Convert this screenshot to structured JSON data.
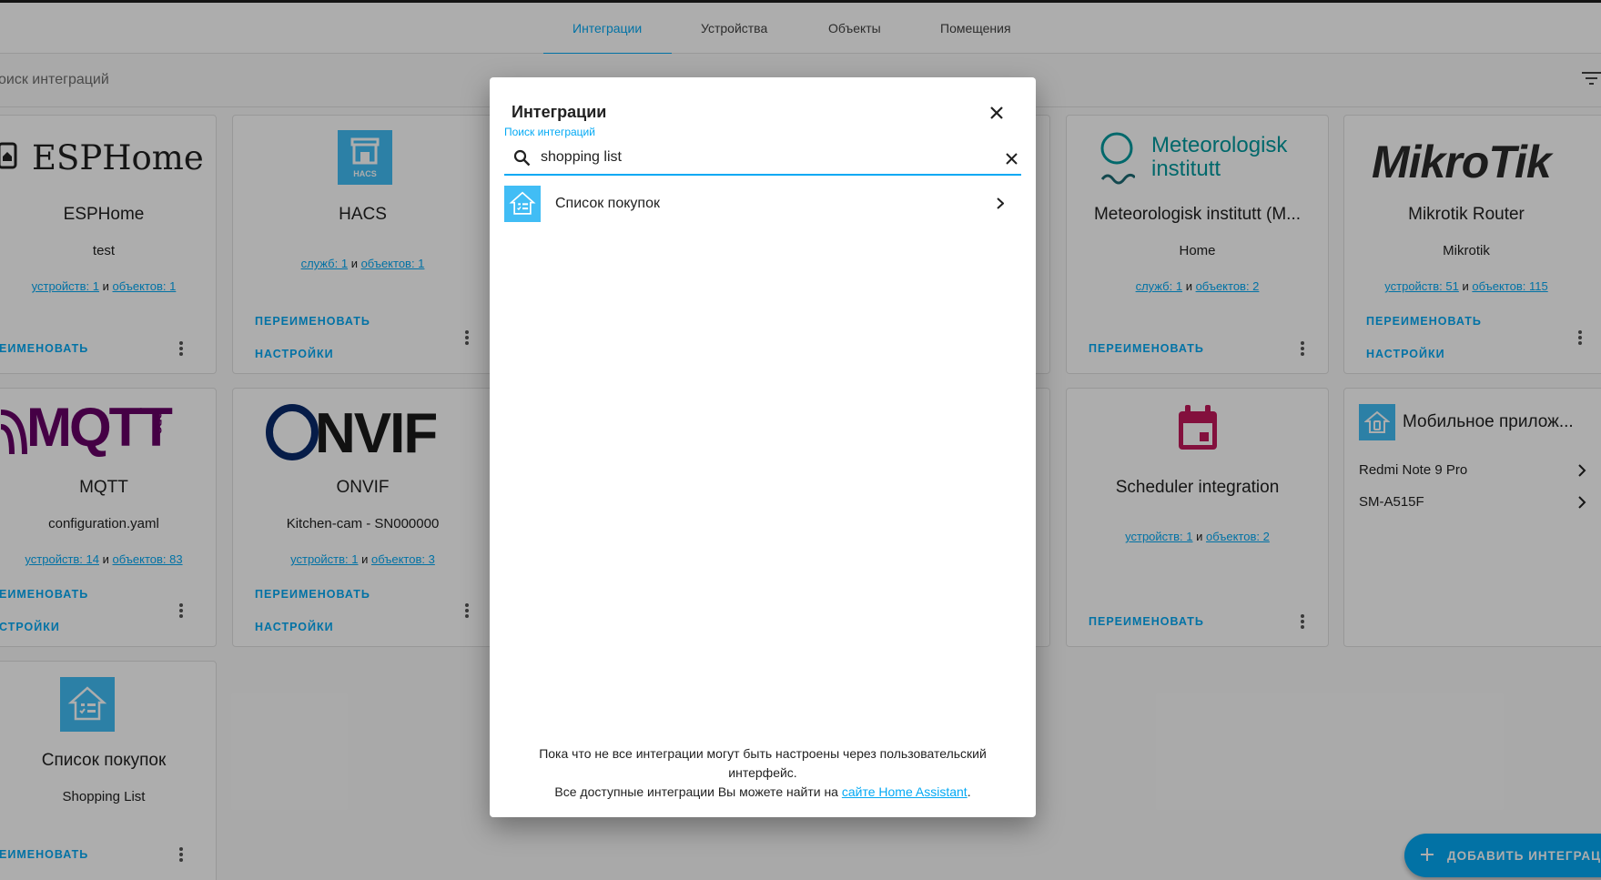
{
  "tabs": [
    {
      "label": "Интеграции",
      "active": true
    },
    {
      "label": "Устройства"
    },
    {
      "label": "Объекты"
    },
    {
      "label": "Помещения"
    }
  ],
  "search": {
    "placeholder": "оиск интеграций"
  },
  "cards": {
    "esphome": {
      "logo_text": "ESPHome",
      "title": "ESPHome",
      "subtitle": "test",
      "link1": "устройств: 1",
      "sep": "и",
      "link2": "объектов: 1",
      "action1": "ЕИМЕНОВАТЬ"
    },
    "hacs": {
      "logo_text": "HACS",
      "title": "HACS",
      "link1": "служб: 1",
      "sep": "и",
      "link2": "объектов: 1",
      "action1": "ПЕРЕИМЕНОВАТЬ",
      "action2": "НАСТРОЙКИ"
    },
    "met": {
      "logo_line1": "Meteorologisk",
      "logo_line2": "institutt",
      "title": "Meteorologisk institutt (M...",
      "subtitle": "Home",
      "link1": "служб: 1",
      "sep": "и",
      "link2": "объектов: 2",
      "action1": "ПЕРЕИМЕНОВАТЬ"
    },
    "mikrotik": {
      "logo_text": "MikroTik",
      "title": "Mikrotik Router",
      "subtitle": "Mikrotik",
      "link1": "устройств: 51",
      "sep": "и",
      "link2": "объектов: 115",
      "action1": "ПЕРЕИМЕНОВАТЬ",
      "action2": "НАСТРОЙКИ"
    },
    "mqtt": {
      "logo_text": "MQTT",
      "logo_org": ".ORG",
      "title": "MQTT",
      "subtitle": "configuration.yaml",
      "link1": "устройств: 14",
      "sep": "и",
      "link2": "объектов: 83",
      "action1": "ЕИМЕНОВАТЬ",
      "action2": "СТРОЙКИ"
    },
    "onvif": {
      "logo_text": "NVIF",
      "title": "ONVIF",
      "subtitle": "Kitchen-cam - SN000000",
      "link1": "устройств: 1",
      "sep": "и",
      "link2": "объектов: 3",
      "action1": "ПЕРЕИМЕНОВАТЬ",
      "action2": "НАСТРОЙКИ"
    },
    "scheduler": {
      "title": "Scheduler integration",
      "link1": "устройств: 1",
      "sep": "и",
      "link2": "объектов: 2",
      "action1": "ПЕРЕИМЕНОВАТЬ"
    },
    "mobile": {
      "title": "Мобильное прилож...",
      "items": [
        "Redmi Note 9 Pro",
        "SM-A515F"
      ]
    },
    "shopping": {
      "title": "Список покупок",
      "subtitle": "Shopping List",
      "action1": "ЕИМЕНОВАТЬ"
    }
  },
  "fab": {
    "label": "ДОБАВИТЬ ИНТЕГРАЦИЮ"
  },
  "dialog": {
    "title": "Интеграции",
    "field_label": "Поиск интеграций",
    "query": "shopping list",
    "results": [
      {
        "label": "Список покупок"
      }
    ],
    "footer_line1": "Пока что не все интеграции могут быть настроены через пользовательский интерфейс.",
    "footer_line2_prefix": "Все доступные интеграции Вы можете найти на",
    "footer_link": "сайте Home Assistant",
    "footer_suffix": "."
  },
  "colors": {
    "accent": "#03a9f4",
    "hacs_blue": "#41bdf5",
    "scheduler_red": "#c2185b",
    "mqtt_purple": "#660066"
  }
}
